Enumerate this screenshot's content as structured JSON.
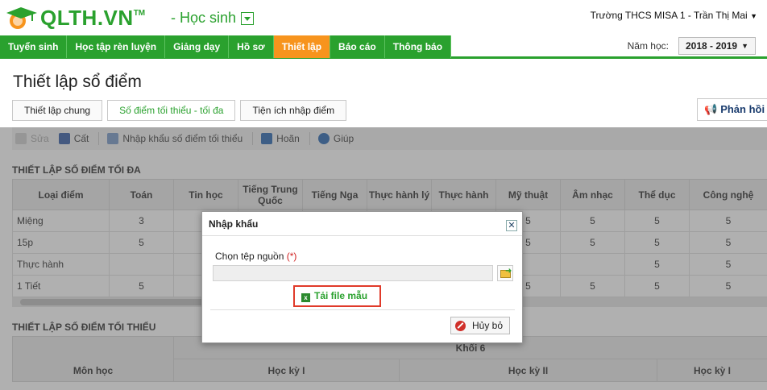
{
  "app": {
    "logo_text": "QLTH.VN",
    "logo_tm": "TM",
    "role": "- Học sinh",
    "school_user": "Trường THCS MISA 1  -  Trần Thị Mai"
  },
  "nav": {
    "items": [
      "Tuyển sinh",
      "Học tập rèn luyện",
      "Giảng dạy",
      "Hồ sơ",
      "Thiết lập",
      "Báo cáo",
      "Thông báo"
    ],
    "active_index": 4
  },
  "year": {
    "label": "Năm học:",
    "value": "2018 - 2019"
  },
  "page": {
    "title": "Thiết lập sổ điểm"
  },
  "subtabs": [
    "Thiết lập chung",
    "Số điểm tối thiểu - tối đa",
    "Tiện ích nhập điểm"
  ],
  "feedback": {
    "label": "Phản hồi"
  },
  "toolbar": {
    "edit": "Sửa",
    "save": "Cất",
    "import": "Nhập khẩu số điểm tối thiểu",
    "undo": "Hoãn",
    "help": "Giúp"
  },
  "max_section": {
    "title": "THIẾT LẬP SỐ ĐIỂM TỐI ĐA",
    "columns": [
      "Loại điểm",
      "Toán",
      "Tin học",
      "Tiếng Trung Quốc",
      "Tiếng Nga",
      "Thực hành lý",
      "Thực hành",
      "Mỹ thuật",
      "Âm nhạc",
      "Thể dục",
      "Công nghệ"
    ],
    "rows": [
      [
        "Miệng",
        "3",
        "",
        "",
        "",
        "",
        "",
        "5",
        "5",
        "5",
        "5"
      ],
      [
        "15p",
        "5",
        "",
        "",
        "",
        "",
        "",
        "5",
        "5",
        "5",
        "5"
      ],
      [
        "Thực hành",
        "",
        "",
        "",
        "",
        "",
        "",
        "",
        "",
        "5",
        "5"
      ],
      [
        "1 Tiết",
        "5",
        "",
        "",
        "",
        "",
        "",
        "5",
        "5",
        "5",
        "5"
      ]
    ]
  },
  "min_section": {
    "title": "THIẾT LẬP SỐ ĐIỂM TỐI THIỂU",
    "subject_header": "Môn học",
    "grade": "Khối 6",
    "terms": [
      "Học kỳ I",
      "Học kỳ II",
      "Học kỳ I"
    ]
  },
  "dialog": {
    "title": "Nhập khẩu",
    "field_label": "Chọn tệp nguồn",
    "required_mark": "(*)",
    "input_value": "",
    "download_link": "Tải file mẫu",
    "cancel": "Hủy bỏ",
    "close": "✕"
  }
}
